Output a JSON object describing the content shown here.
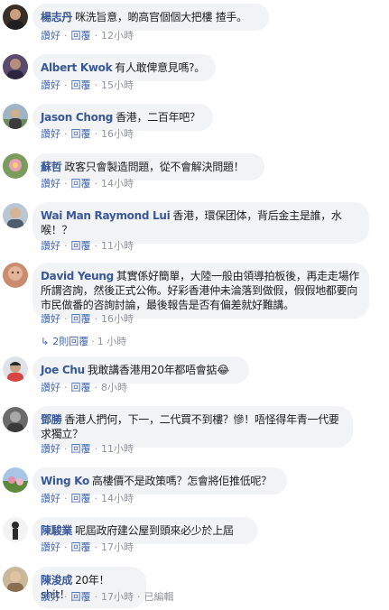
{
  "labels": {
    "like": "讚好",
    "reply": "回覆",
    "separator": "·",
    "edited": "已編輯"
  },
  "replies_link": {
    "arrow": "↳",
    "label": "2則回覆",
    "time": "1 小時"
  },
  "comments": [
    {
      "author": "楊志丹",
      "text": "咪洗旨意，啲高官個個大把樓 揸手。",
      "time": "12小時"
    },
    {
      "author": "Albert Kwok",
      "text": "有人敢俾意見嗎?。",
      "time": "15小時"
    },
    {
      "author": "Jason Chong",
      "text": "香港，二百年吧？",
      "time": "16小時"
    },
    {
      "author": "蘇哲",
      "text": "政客只會製造問題，從不會解決問題！",
      "time": "14小時"
    },
    {
      "author": "Wai Man Raymond Lui",
      "text": "香港，環保团体，背后金主是誰，水喉！？",
      "time": "11小時"
    },
    {
      "author": "David Yeung",
      "text": "其實係好簡單，大陸一般由領導拍板後，再走走場作所謂咨詢，然後正式公佈。好彩香港仲未淪落到做假，假假地都要向市民做番的咨詢討論，最後報告是否有偏差就好難講。",
      "time": "16小時"
    },
    {
      "author": "Joe Chu",
      "text": "我敢講香港用20年都唔會掂😂",
      "time": "8小時"
    },
    {
      "author": "鄧勝",
      "text": "香港人捫何，下一，二代買不到樓？慘！唔怪得年青一代要求獨立？",
      "time": "11小時"
    },
    {
      "author": "Wing Ko",
      "text": "高樓價不是政策嗎？怎會將佢推低呢？",
      "time": "14小時"
    },
    {
      "author": "陳駿業",
      "text": "呢屆政府建公屋到頭來必少於上屆",
      "time": "17小時"
    },
    {
      "author": "陳浚成",
      "text": "20年！shit！",
      "time": "17小時",
      "edited": true
    }
  ]
}
